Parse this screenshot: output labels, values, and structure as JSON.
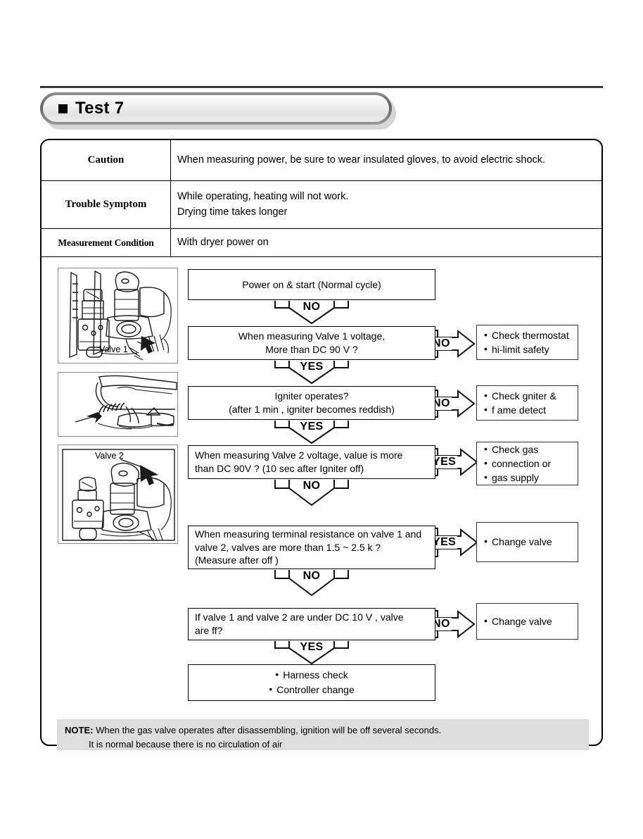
{
  "header": {
    "bullet_icon": "black-square-icon",
    "title": "Test 7"
  },
  "info": {
    "rows": [
      {
        "label": "Caution",
        "value": "When measuring power, be sure to wear insulated gloves, to avoid electric shock."
      },
      {
        "label": "Trouble Symptom",
        "line1": "While operating, heating will not work.",
        "line2": "Drying time takes longer"
      },
      {
        "label": "Measurement Condition",
        "value": "With dryer power on"
      }
    ]
  },
  "photos": [
    {
      "caption": "Valve 1",
      "alt": "gas-valve-assembly-valve-1"
    },
    {
      "caption": "",
      "alt": "igniter-coil-closeup"
    },
    {
      "caption": "Valve 2",
      "alt": "gas-valve-assembly-valve-2"
    }
  ],
  "flow": {
    "steps": [
      {
        "id": "start",
        "line1": "Power on & start (Normal cycle)"
      },
      {
        "id": "valve1-voltage",
        "line1": "When measuring Valve 1 voltage,",
        "line2": "More than  DC 90 V     ?"
      },
      {
        "id": "igniter-operates",
        "line1": "Igniter operates?",
        "line2": "(after 1 min       ,  igniter becomes reddish)"
      },
      {
        "id": "valve2-voltage",
        "line1": "When measuring Valve 2 voltage, value is more",
        "line2": "than DC 90V    ? (10 sec after Igniter off)"
      },
      {
        "id": "terminal-resistance",
        "line1": "When measuring terminal resistance on valve 1 and",
        "line2": "valve 2, valves are more than  1.5 ~ 2.5 k   ?",
        "line3": "(Measure after off )"
      },
      {
        "id": "under-dc10v",
        "line1": "If valve 1 and valve 2 are under DC 10 V      , valve",
        "line2": "are    ff?"
      }
    ],
    "connectors": [
      {
        "id": "start-to-valve1",
        "label": "NO",
        "dir": "down"
      },
      {
        "id": "valve1-yes",
        "label": "YES",
        "dir": "down"
      },
      {
        "id": "igniter-yes",
        "label": "YES",
        "dir": "down"
      },
      {
        "id": "valve2-no",
        "label": "NO",
        "dir": "down"
      },
      {
        "id": "resistance-no",
        "label": "NO",
        "dir": "down"
      },
      {
        "id": "dc10v-yes",
        "label": "YES",
        "dir": "down"
      },
      {
        "id": "valve1-no-right",
        "label": "NO",
        "dir": "right"
      },
      {
        "id": "igniter-no-right",
        "label": "NO",
        "dir": "right"
      },
      {
        "id": "valve2-yes-right",
        "label": "YES",
        "dir": "right"
      },
      {
        "id": "resistance-yes-right",
        "label": "YES",
        "dir": "right"
      },
      {
        "id": "dc10v-no-right",
        "label": "NO",
        "dir": "right"
      }
    ],
    "results": [
      {
        "id": "check-thermostat",
        "items": [
          "Check thermostat",
          "hi-limit safety"
        ]
      },
      {
        "id": "check-igniter",
        "items": [
          "Check  gniter &",
          "f ame detect"
        ]
      },
      {
        "id": "check-gas",
        "items": [
          "Check gas",
          "connection or",
          "gas supply"
        ]
      },
      {
        "id": "change-valve-1",
        "items": [
          "Change valve"
        ]
      },
      {
        "id": "change-valve-2",
        "items": [
          "Change valve"
        ]
      }
    ],
    "final": {
      "line1": "Harness check",
      "line2": "Controller change"
    }
  },
  "note": {
    "header": "NOTE:",
    "line1": "When the gas valve operates after disassembling, ignition will be off several seconds.",
    "line2": "It is normal because there is no  circulation of air"
  },
  "colors": {
    "rule": "#3a3a3a",
    "note_bg": "#dededf",
    "border": "#000000"
  }
}
